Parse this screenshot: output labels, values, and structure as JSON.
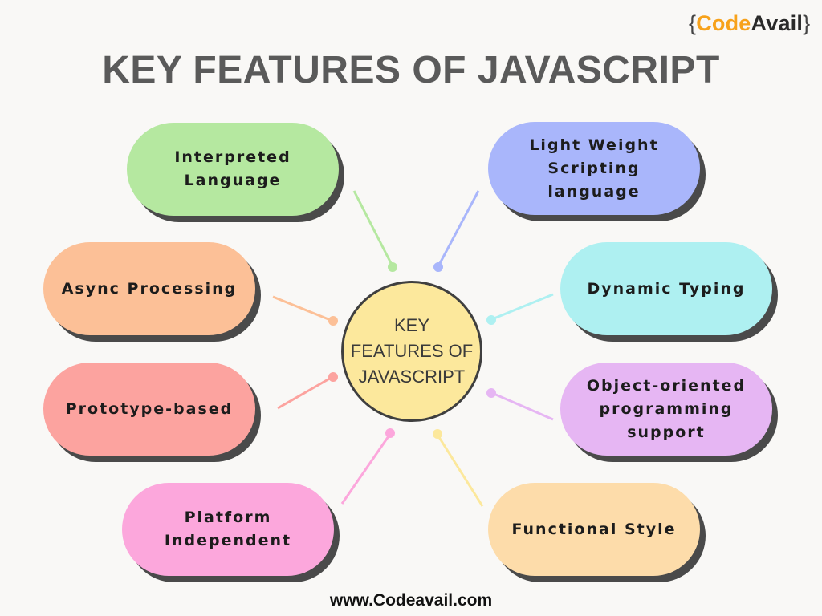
{
  "logo": {
    "brace_open": "{",
    "code": "Code",
    "avail": "Avail",
    "brace_close": "}"
  },
  "title": "KEY FEATURES OF JAVASCRIPT",
  "center": {
    "label": "KEY\nFEATURES OF\nJAVASCRIPT",
    "color": "#fce89c"
  },
  "features": [
    {
      "id": "interpreted-language",
      "label": "Interpreted\nLanguage",
      "color": "#b5e8a0"
    },
    {
      "id": "light-weight-scripting",
      "label": "Light Weight\nScripting language",
      "color": "#a9b6fb"
    },
    {
      "id": "async-processing",
      "label": "Async Processing",
      "color": "#fcc097"
    },
    {
      "id": "dynamic-typing",
      "label": "Dynamic Typing",
      "color": "#aef0f1"
    },
    {
      "id": "prototype-based",
      "label": "Prototype-based",
      "color": "#fca39f"
    },
    {
      "id": "object-oriented",
      "label": "Object-oriented\nprogramming\nsupport",
      "color": "#e6b6f3"
    },
    {
      "id": "platform-independent",
      "label": "Platform\nIndependent",
      "color": "#fca7dc"
    },
    {
      "id": "functional-style",
      "label": "Functional Style",
      "color": "#fddcaa"
    }
  ],
  "footer": "www.Codeavail.com"
}
